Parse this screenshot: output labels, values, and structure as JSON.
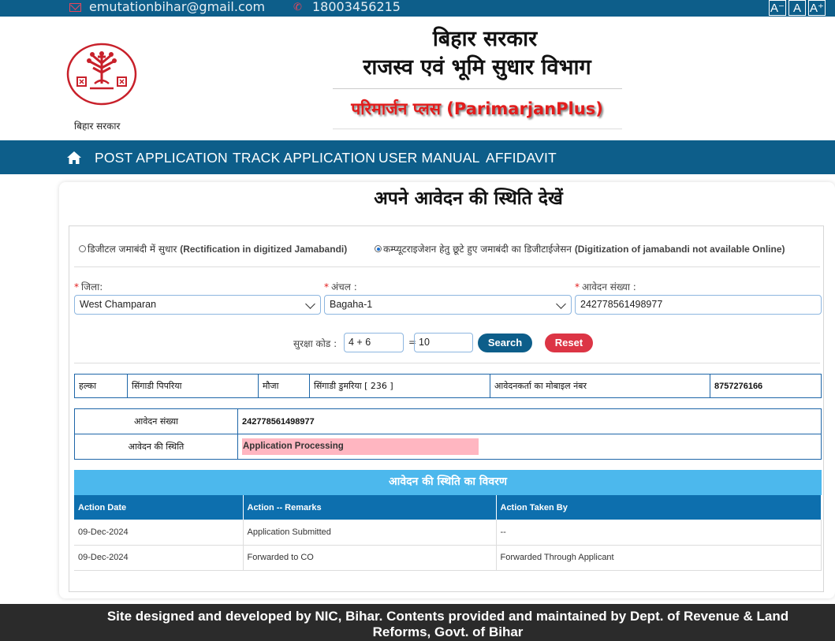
{
  "topbar": {
    "email": "emutationbihar@gmail.com",
    "phone": "18003456215",
    "font_buttons": [
      "A⁻",
      "A",
      "A⁺"
    ]
  },
  "header": {
    "emblem_caption": "बिहार सरकार",
    "title_line1": "बिहार सरकार",
    "title_line2": "राजस्व एवं भूमि सुधार विभाग",
    "title_line3": "परिमार्जन प्लस (ParimarjanPlus)"
  },
  "nav": {
    "items": [
      "POST APPLICATION",
      "TRACK APPLICATION",
      "USER MANUAL",
      "AFFIDAVIT"
    ]
  },
  "page": {
    "heading": "अपने आवेदन की स्थिति देखें"
  },
  "form": {
    "radio1_hi": "डिजीटल जमाबंदी में सुधार",
    "radio1_en": "(Rectification in digitized Jamabandi)",
    "radio2_hi": "कम्प्यूटराइजेशन हेतु छूटे हुए जमाबंदी का डिजीटाईजेसन",
    "radio2_en": "(Digitization of jamabandi not available Online)",
    "district_label": "जिला:",
    "district_value": "West Champaran",
    "circle_label": "अंचल :",
    "circle_value": "Bagaha-1",
    "app_no_label": "आवेदन संख्या :",
    "app_no_value": "242778561498977",
    "captcha_label": "सुरक्षा कोड :",
    "captcha_question": "4 + 6",
    "captcha_eq": "=",
    "captcha_answer": "10",
    "search_label": "Search",
    "reset_label": "Reset"
  },
  "info": {
    "halka_label": "हल्का",
    "halka_value": "सिंगाडी पिपरिया",
    "mauja_label": "मौजा",
    "mauja_value": "सिंगाडी डुमरिया [ 236 ]",
    "mobile_label": "आवेदनकर्ता का मोबाइल नंबर",
    "mobile_value": "8757276166"
  },
  "status": {
    "app_no_label": "आवेदन संख्या",
    "app_no_value": "242778561498977",
    "status_label": "आवेदन की स्थिति",
    "status_value": "Application Processing"
  },
  "details": {
    "heading": "आवेदन की स्थिति का विवरण",
    "columns": [
      "Action Date",
      "Action -- Remarks",
      "Action Taken By"
    ],
    "rows": [
      [
        "09-Dec-2024",
        "Application Submitted",
        "--"
      ],
      [
        "09-Dec-2024",
        "Forwarded to CO",
        "Forwarded Through Applicant"
      ]
    ]
  },
  "footer": {
    "text": "Site designed and developed by NIC, Bihar. Contents provided and maintained by Dept. of Revenue & Land Reforms, Govt. of Bihar"
  },
  "colors": {
    "nav_blue": "#0d5e8a",
    "detail_head": "#4cb8ed",
    "search_btn": "#0d5e8a",
    "reset_btn": "#dc3545",
    "status_fill": "#ffb6c1",
    "title_red": "#e21c1c"
  },
  "icons": {
    "mail": "mail-icon",
    "phone": "phone-icon",
    "home": "home-icon",
    "emblem": "bihar-emblem-icon"
  }
}
